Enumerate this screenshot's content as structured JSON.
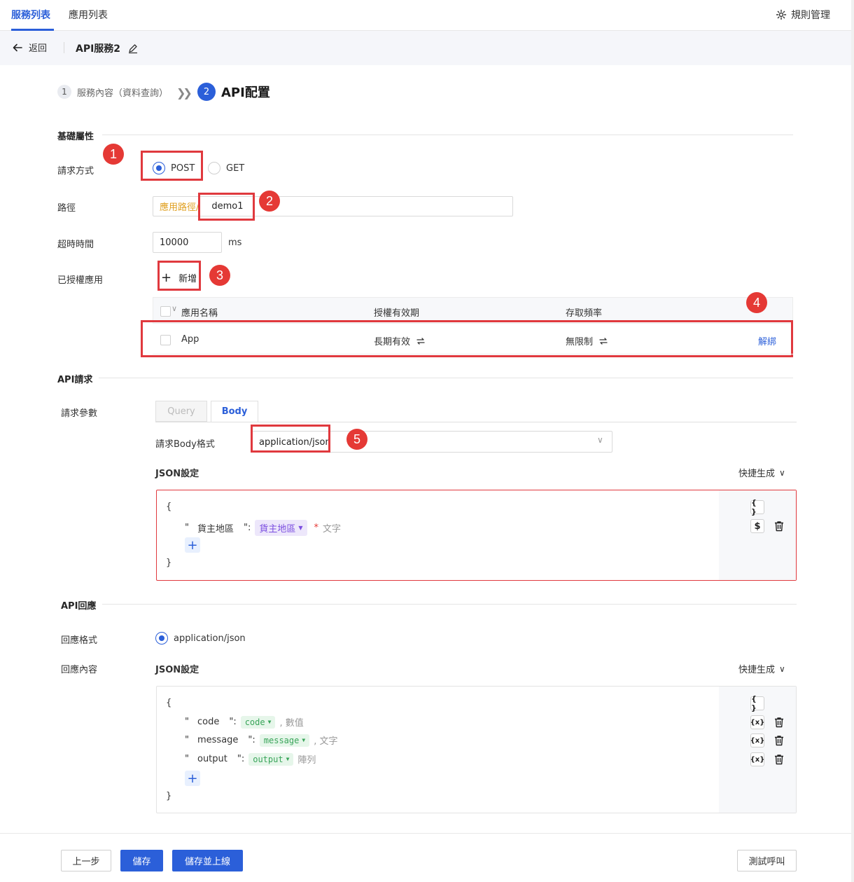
{
  "top_tabs": [
    "服務列表",
    "應用列表"
  ],
  "rules_label": "規則管理",
  "header": {
    "back_label": "返回",
    "service_name": "API服務2"
  },
  "steps": {
    "step1_num": "1",
    "step1_label": "服務內容（資料查詢）",
    "step2_num": "2",
    "step2_label": "API配置"
  },
  "sections": {
    "basic": "基礎屬性",
    "request": "API請求",
    "response": "API回應"
  },
  "basic": {
    "method_label": "請求方式",
    "method_post": "POST",
    "method_get": "GET",
    "method_selected": "POST",
    "path_label": "路徑",
    "path_prefix": "應用路徑/",
    "path_value": "demo1",
    "timeout_label": "超時時間",
    "timeout_value": "10000",
    "timeout_unit": "ms",
    "authorized_label": "已授權應用",
    "add_label": "新增"
  },
  "auth_table": {
    "columns": [
      "應用名稱",
      "授權有效期",
      "存取頻率"
    ],
    "rows": [
      {
        "name": "App",
        "validity": "長期有效",
        "frequency": "無限制",
        "action": "解綁"
      }
    ]
  },
  "request": {
    "params_label": "請求參數",
    "tabs": [
      "Query",
      "Body"
    ],
    "active_tab": "Body",
    "body_format_label": "請求Body格式",
    "body_format_value": "application/json",
    "json_settings_label": "JSON設定",
    "quick_generate_label": "快捷生成",
    "open_brace": "{",
    "close_brace": "}",
    "fields": [
      {
        "key": "貨主地區",
        "tag": "貨主地區",
        "required": "*",
        "type": "文字"
      }
    ]
  },
  "response": {
    "format_label": "回應格式",
    "format_value": "application/json",
    "content_label": "回應內容",
    "json_settings_label": "JSON設定",
    "quick_generate_label": "快捷生成",
    "open_brace": "{",
    "close_brace": "}",
    "fields": [
      {
        "key": "code",
        "tag": "code",
        "type": "數值"
      },
      {
        "key": "message",
        "tag": "message",
        "type": "文字"
      },
      {
        "key": "output",
        "tag": "output",
        "type": "陣列"
      }
    ]
  },
  "badges": [
    "1",
    "2",
    "3",
    "4",
    "5"
  ],
  "footer": {
    "prev_label": "上一步",
    "save_label": "儲存",
    "save_publish_label": "儲存並上線",
    "test_label": "測試呼叫"
  },
  "colors": {
    "primary": "#2b5fd9",
    "annotation_red": "#e0393e",
    "prefix_orange": "#e0a020"
  }
}
